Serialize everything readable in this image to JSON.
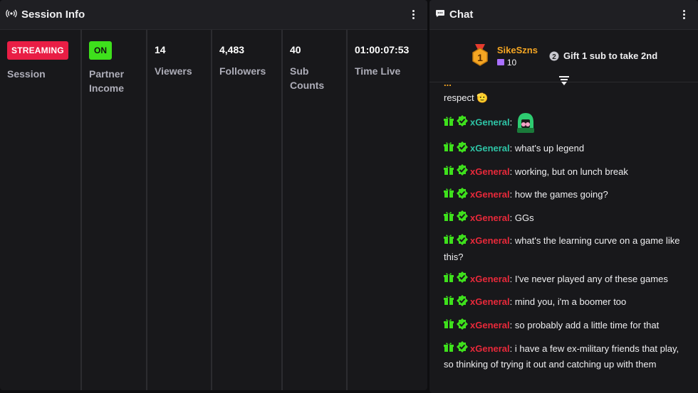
{
  "session": {
    "title": "Session Info",
    "stats": [
      {
        "badge": "STREAMING",
        "label": "Session"
      },
      {
        "badge": "ON",
        "label": "Partner Income"
      },
      {
        "value": "14",
        "label": "Viewers"
      },
      {
        "value": "4,483",
        "label": "Followers"
      },
      {
        "value": "40",
        "label": "Sub Counts"
      },
      {
        "value": "01:00:07:53",
        "label": "Time Live"
      }
    ],
    "colors": {
      "streaming": "#e91e45",
      "on": "#3ee01c"
    }
  },
  "chat": {
    "title": "Chat",
    "leader": {
      "name": "SikeSzns",
      "count": "10",
      "rank": "1"
    },
    "second": {
      "rank": "2",
      "text": "Gift 1 sub to take 2nd"
    },
    "partial_top": {
      "user": "...",
      "text": "respect 🫡"
    },
    "messages": [
      {
        "user": "xGeneral",
        "color": "#2ec4a6",
        "text": "",
        "emote": true
      },
      {
        "user": "xGeneral",
        "color": "#2ec4a6",
        "text": ": what's up legend"
      },
      {
        "user": "xGeneral",
        "color": "#e8293a",
        "text": ": working, but on lunch break"
      },
      {
        "user": "xGeneral",
        "color": "#e8293a",
        "text": ": how the games going?"
      },
      {
        "user": "xGeneral",
        "color": "#e8293a",
        "text": ": GGs"
      },
      {
        "user": "xGeneral",
        "color": "#e8293a",
        "text": ": what's the learning curve on a game like this?"
      },
      {
        "user": "xGeneral",
        "color": "#e8293a",
        "text": ": I've never played any of these games"
      },
      {
        "user": "xGeneral",
        "color": "#e8293a",
        "text": ": mind you, i'm a boomer too"
      },
      {
        "user": "xGeneral",
        "color": "#e8293a",
        "text": ": so probably add a little time for that"
      },
      {
        "user": "xGeneral",
        "color": "#e8293a",
        "text": ": i have a few ex-military friends that play, so thinking of trying it out and catching up with them"
      }
    ]
  }
}
